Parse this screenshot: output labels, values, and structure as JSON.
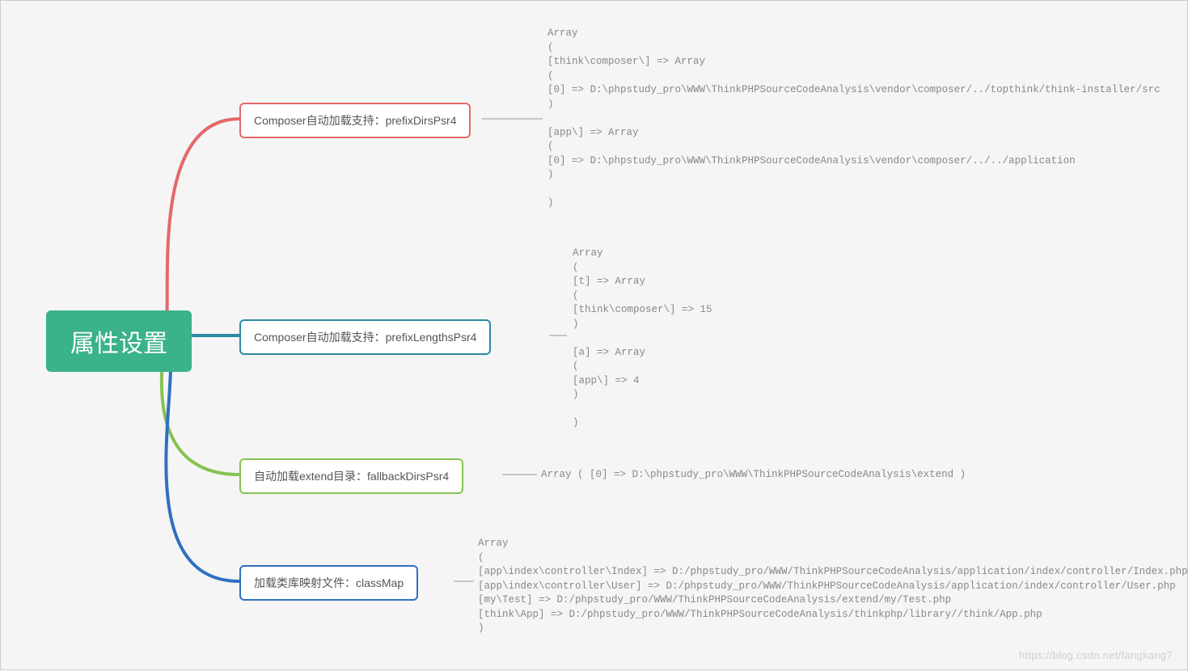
{
  "root": {
    "label": "属性设置"
  },
  "branches": {
    "b1": {
      "label": "Composer自动加载支持：prefixDirsPsr4"
    },
    "b2": {
      "label": "Composer自动加载支持：prefixLengthsPsr4"
    },
    "b3": {
      "label": "自动加载extend目录：fallbackDirsPsr4"
    },
    "b4": {
      "label": "加载类库映射文件：classMap"
    }
  },
  "leaves": {
    "l1": "Array\n(\n[think\\composer\\] => Array\n(\n[0] => D:\\phpstudy_pro\\WWW\\ThinkPHPSourceCodeAnalysis\\vendor\\composer/../topthink/think-installer/src\n)\n\n[app\\] => Array\n(\n[0] => D:\\phpstudy_pro\\WWW\\ThinkPHPSourceCodeAnalysis\\vendor\\composer/../../application\n)\n\n)",
    "l2": "Array\n(\n[t] => Array\n(\n[think\\composer\\] => 15\n)\n\n[a] => Array\n(\n[app\\] => 4\n)\n\n)",
    "l3": "Array ( [0] => D:\\phpstudy_pro\\WWW\\ThinkPHPSourceCodeAnalysis\\extend )",
    "l4": "Array\n(\n[app\\index\\controller\\Index] => D:/phpstudy_pro/WWW/ThinkPHPSourceCodeAnalysis/application/index/controller/Index.php\n[app\\index\\controller\\User] => D:/phpstudy_pro/WWW/ThinkPHPSourceCodeAnalysis/application/index/controller/User.php\n[my\\Test] => D:/phpstudy_pro/WWW/ThinkPHPSourceCodeAnalysis/extend/my/Test.php\n[think\\App] => D:/phpstudy_pro/WWW/ThinkPHPSourceCodeAnalysis/thinkphp/library//think/App.php\n)"
  },
  "watermark": "https://blog.csdn.net/fangkang7",
  "colors": {
    "red": "#e56869",
    "teal": "#2d8aa3",
    "green": "#86c251",
    "blue": "#2f70c1"
  }
}
